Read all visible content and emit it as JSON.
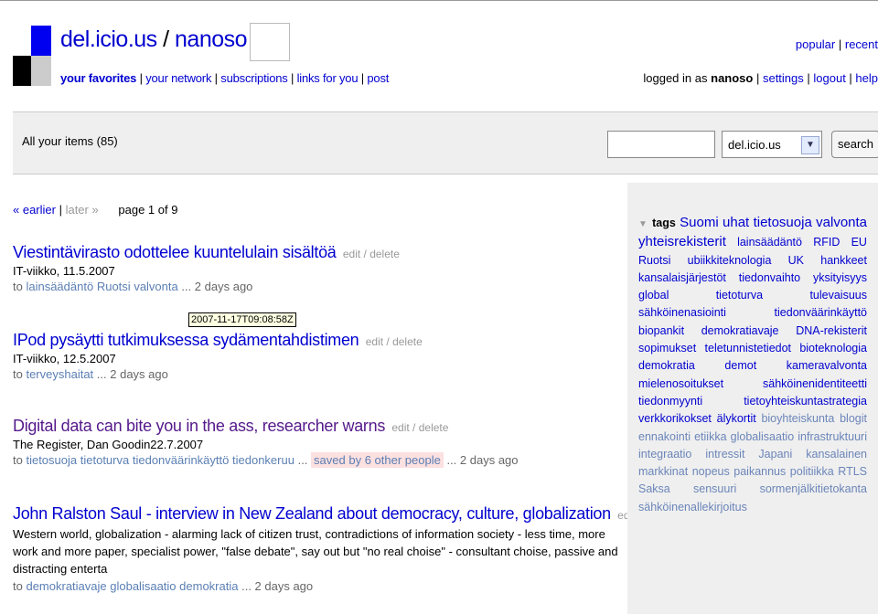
{
  "header": {
    "site": "del.icio.us",
    "slash1": " / ",
    "user": "nanoso",
    "slash2": " /",
    "nav": {
      "your_favorites": "your favorites",
      "your_network": "your network",
      "subscriptions": "subscriptions",
      "links_for_you": "links for you",
      "post": "post"
    },
    "popular": "popular",
    "recent": "recent",
    "logged_in_as": "logged in as",
    "username": "nanoso",
    "settings": "settings",
    "logout": "logout",
    "help": "help"
  },
  "itembar": {
    "all_items": "All your items (85)",
    "search_select": "del.icio.us",
    "search_button": "search"
  },
  "pager": {
    "earlier": "« earlier",
    "later": "later »",
    "page": "page 1 of 9"
  },
  "posts": [
    {
      "title": "Viestintävirasto odottelee kuuntelulain sisältöä",
      "edit": "edit / delete",
      "source": "IT-viikko, 11.5.2007",
      "to": "to",
      "tags": [
        "lainsäädäntö",
        "Ruotsi",
        "valvonta"
      ],
      "age": "... 2 days ago"
    },
    {
      "title": "IPod pysäytti tutkimuksessa sydämentahdistimen",
      "edit": "edit / delete",
      "source": "IT-viikko, 12.5.2007",
      "to": "to",
      "tags": [
        "terveyshaitat"
      ],
      "age": "... 2 days ago"
    },
    {
      "title": "Digital data can bite you in the ass, researcher warns",
      "edit": "edit / delete",
      "source": "The Register, Dan Goodin22.7.2007",
      "to": "to",
      "tags": [
        "tietosuoja",
        "tietoturva",
        "tiedonväärinkäyttö",
        "tiedonkeruu"
      ],
      "ellipsis": "...",
      "saved": "saved by 6 other people",
      "age": "... 2 days ago"
    },
    {
      "title": "John Ralston Saul - interview in New Zealand about democracy, culture, globalization",
      "edit": "edit / delete",
      "description": "Western world, globalization - alarming lack of citizen trust, contradictions of information society - less time, more work and more paper, specialist power, \"false debate\", say out but \"no real choise\" - consultant choise, passive and distracting enterta",
      "to": "to",
      "tags": [
        "demokratiavaje",
        "globalisaatio",
        "demokratia"
      ],
      "age": "... 2 days ago"
    }
  ],
  "tooltip": "2007-11-17T09:08:58Z",
  "tags_panel": {
    "label": "tags",
    "arrow": "▼",
    "tags": [
      {
        "t": "Suomi",
        "c": "big"
      },
      {
        "t": "uhat",
        "c": "big"
      },
      {
        "t": "tietosuoja",
        "c": "big"
      },
      {
        "t": "valvonta",
        "c": "big"
      },
      {
        "t": "yhteisrekisterit",
        "c": "big"
      },
      {
        "t": "lainsäädäntö",
        "c": ""
      },
      {
        "t": "RFID",
        "c": ""
      },
      {
        "t": "EU",
        "c": ""
      },
      {
        "t": "Ruotsi",
        "c": ""
      },
      {
        "t": "ubiikkiteknologia",
        "c": ""
      },
      {
        "t": "UK",
        "c": ""
      },
      {
        "t": "hankkeet",
        "c": ""
      },
      {
        "t": "kansalaisjärjestöt",
        "c": ""
      },
      {
        "t": "tiedonvaihto",
        "c": ""
      },
      {
        "t": "yksityisyys",
        "c": ""
      },
      {
        "t": "global",
        "c": ""
      },
      {
        "t": "tietoturva",
        "c": ""
      },
      {
        "t": "tulevaisuus",
        "c": ""
      },
      {
        "t": "sähköinenasiointi",
        "c": ""
      },
      {
        "t": "tiedonväärinkäyttö",
        "c": ""
      },
      {
        "t": "biopankit",
        "c": ""
      },
      {
        "t": "demokratiavaje",
        "c": ""
      },
      {
        "t": "DNA-rekisterit",
        "c": ""
      },
      {
        "t": "sopimukset",
        "c": ""
      },
      {
        "t": "teletunnistetiedot",
        "c": ""
      },
      {
        "t": "bioteknologia",
        "c": ""
      },
      {
        "t": "demokratia",
        "c": ""
      },
      {
        "t": "demot",
        "c": ""
      },
      {
        "t": "kameravalvonta",
        "c": ""
      },
      {
        "t": "mielenosoitukset",
        "c": ""
      },
      {
        "t": "sähköinenidentiteetti",
        "c": ""
      },
      {
        "t": "tiedonmyynti",
        "c": ""
      },
      {
        "t": "tietoyhteiskuntastrategia",
        "c": ""
      },
      {
        "t": "verkkorikokset",
        "c": ""
      },
      {
        "t": "älykortit",
        "c": ""
      },
      {
        "t": "bioyhteiskunta",
        "c": "lt"
      },
      {
        "t": "blogit",
        "c": "lt"
      },
      {
        "t": "ennakointi",
        "c": "lt"
      },
      {
        "t": "etiikka",
        "c": "lt"
      },
      {
        "t": "globalisaatio",
        "c": "lt"
      },
      {
        "t": "infrastruktuuri",
        "c": "lt"
      },
      {
        "t": "integraatio",
        "c": "lt"
      },
      {
        "t": "intressit",
        "c": "lt"
      },
      {
        "t": "Japani",
        "c": "lt"
      },
      {
        "t": "kansalainen",
        "c": "lt"
      },
      {
        "t": "markkinat",
        "c": "lt"
      },
      {
        "t": "nopeus",
        "c": "lt"
      },
      {
        "t": "paikannus",
        "c": "lt"
      },
      {
        "t": "politiikka",
        "c": "lt"
      },
      {
        "t": "RTLS",
        "c": "lt"
      },
      {
        "t": "Saksa",
        "c": "lt"
      },
      {
        "t": "sensuuri",
        "c": "lt"
      },
      {
        "t": "sormenjälkitietokanta",
        "c": "lt"
      },
      {
        "t": "sähköinenallekirjoitus",
        "c": "lt"
      }
    ]
  }
}
